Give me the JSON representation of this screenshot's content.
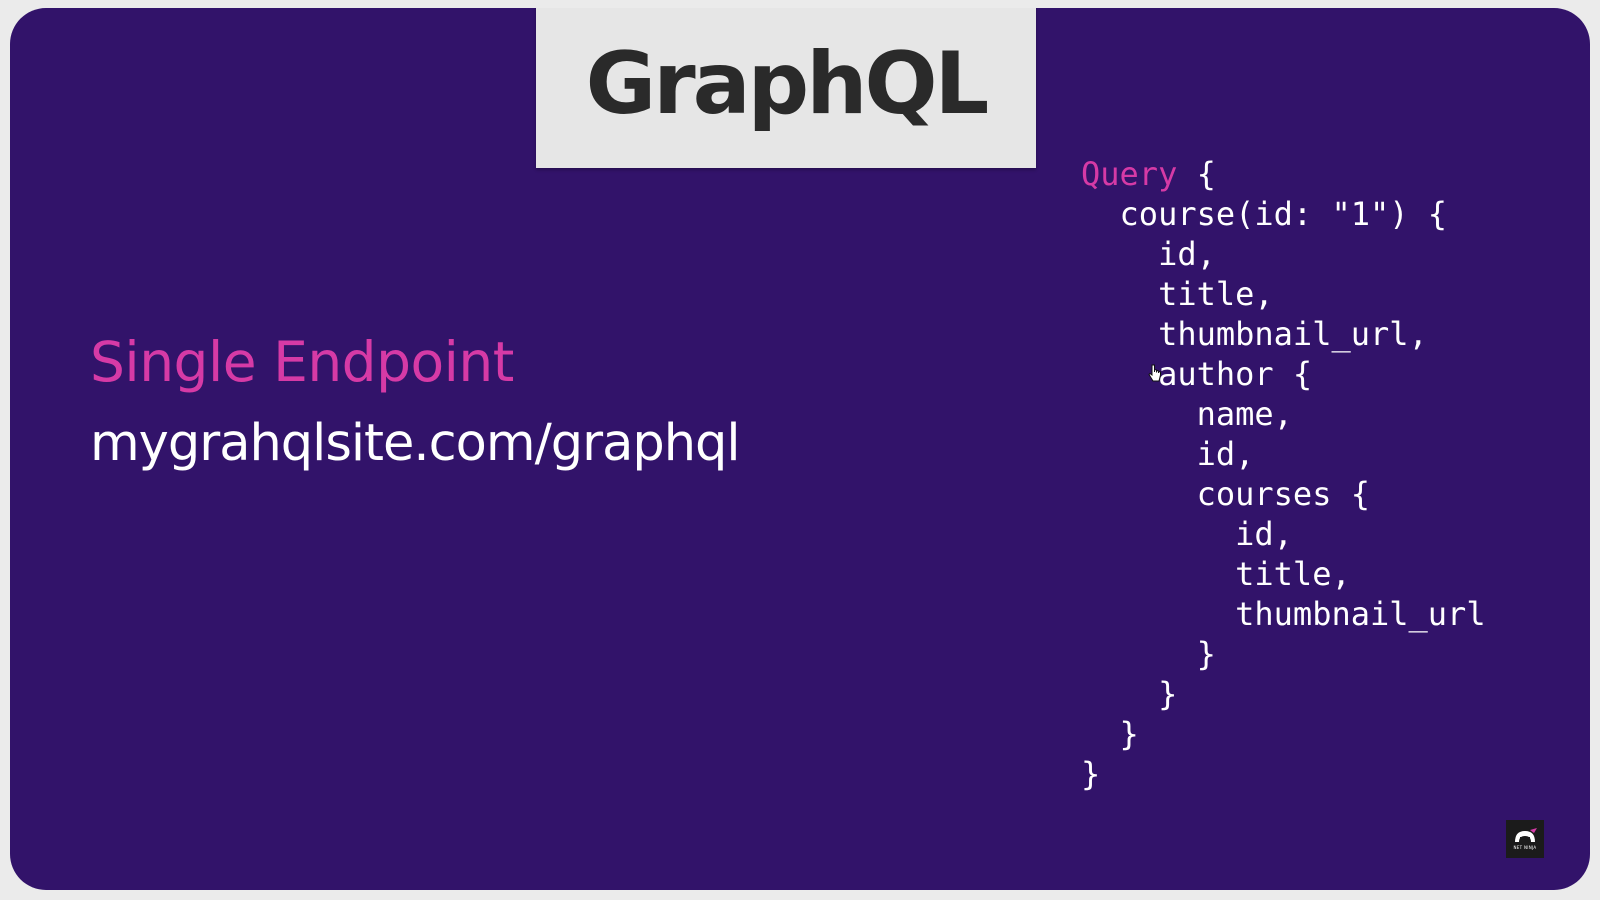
{
  "slide": {
    "title": "GraphQL",
    "heading": "Single Endpoint",
    "url": "mygrahqlsite.com/graphql",
    "logo_text": "NET NINJA"
  },
  "code": {
    "keyword": "Query",
    "lines": [
      " {",
      "  course(id: \"1\") {",
      "    id,",
      "    title,",
      "    thumbnail_url,",
      "    author {",
      "      name,",
      "      id,",
      "      courses {",
      "        id,",
      "        title,",
      "        thumbnail_url",
      "      }",
      "    }",
      "  }",
      "}"
    ]
  },
  "colors": {
    "background": "#32136a",
    "accent": "#d63aa6",
    "title_card": "#e6e6e6",
    "text": "#ffffff"
  },
  "icons": {
    "cursor": "hand-pointer-icon",
    "logo": "net-ninja-logo-icon"
  }
}
